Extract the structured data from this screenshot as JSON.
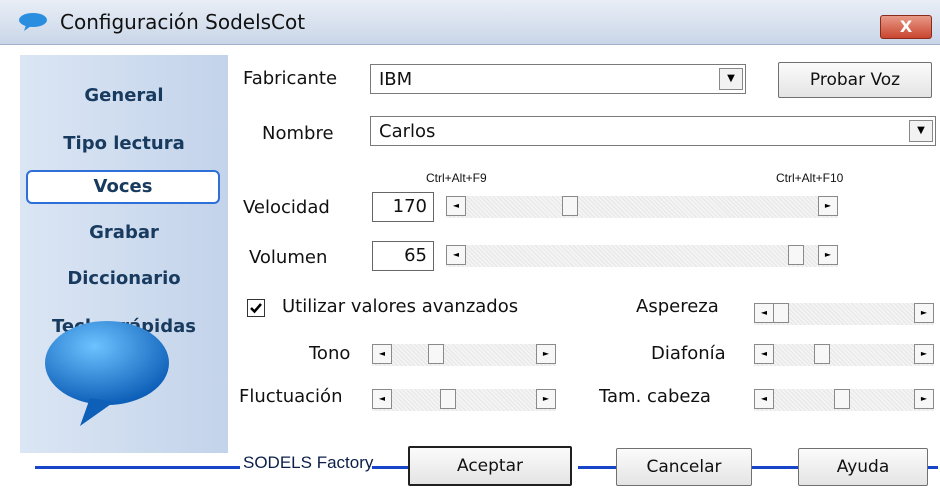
{
  "window": {
    "title": "Configuración SodelsCot",
    "close_label": "X"
  },
  "sidebar": {
    "items": [
      {
        "label": "General"
      },
      {
        "label": "Tipo lectura"
      },
      {
        "label": "Voces"
      },
      {
        "label": "Grabar"
      },
      {
        "label": "Diccionario"
      },
      {
        "label": "Teclas rápidas"
      }
    ],
    "active": "Voces"
  },
  "voice": {
    "fabricante_label": "Fabricante",
    "fabricante_value": "IBM",
    "probar_label": "Probar Voz",
    "nombre_label": "Nombre",
    "nombre_value": "Carlos"
  },
  "sliders": {
    "velocidad_label": "Velocidad",
    "velocidad_value": "170",
    "velocidad_shortcut_left": "Ctrl+Alt+F9",
    "velocidad_shortcut_right": "Ctrl+Alt+F10",
    "volumen_label": "Volumen",
    "volumen_value": "65"
  },
  "advanced": {
    "checkbox_label": "Utilizar valores avanzados",
    "checked": true,
    "tono_label": "Tono",
    "fluctuacion_label": "Fluctuación",
    "aspereza_label": "Aspereza",
    "diafonia_label": "Diafonía",
    "tam_cabeza_label": "Tam. cabeza"
  },
  "footer": {
    "brand": "SODELS Factory",
    "aceptar_label": "Aceptar",
    "cancelar_label": "Cancelar",
    "ayuda_label": "Ayuda"
  },
  "colors": {
    "accent": "#1745c9",
    "sidebar_text": "#173a5e"
  }
}
